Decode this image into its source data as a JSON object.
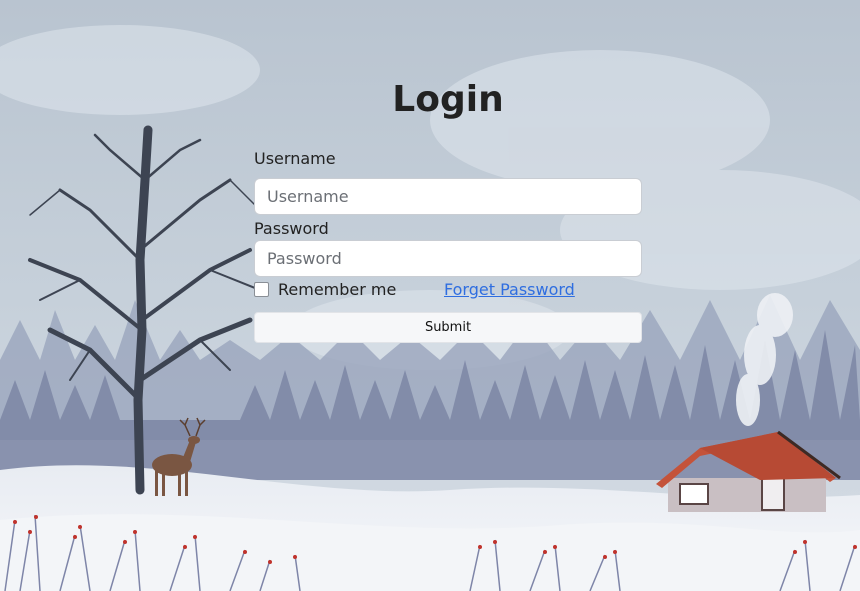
{
  "login": {
    "title": "Login",
    "username_label": "Username",
    "username_placeholder": "Username",
    "username_value": "",
    "password_label": "Password",
    "password_placeholder": "Password",
    "password_value": "",
    "remember_label": "Remember me",
    "remember_checked": false,
    "forgot_link": "Forget Password",
    "submit_label": "Submit"
  },
  "colors": {
    "sky": "#c2cbd6",
    "link": "#2f6ee0",
    "title": "#222222",
    "button_bg": "#f6f7f9",
    "roof": "#c4533a"
  },
  "background": {
    "scene": "winter-landscape",
    "elements": [
      "bare-tree",
      "deer",
      "pine-forest",
      "cabin",
      "chimney-smoke",
      "snow-field",
      "red-berry-grass"
    ]
  }
}
